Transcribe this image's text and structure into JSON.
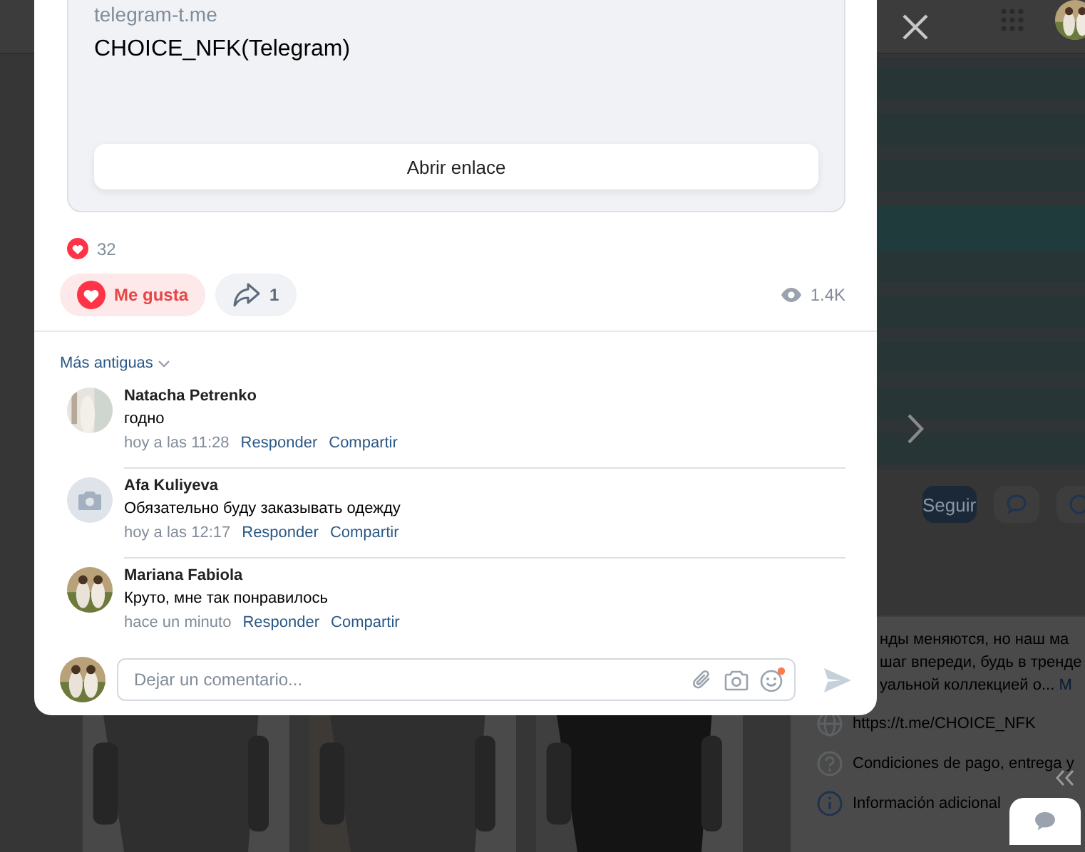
{
  "page": {
    "follow_button": "Seguir",
    "description_lines": [
      "нды меняются, но наш ма",
      "шаг впереди, будь в тренде",
      "уальной коллекцией о..."
    ],
    "more_link": "М",
    "info_links": [
      {
        "kind": "link",
        "text": "https://t.me/CHOICE_NFK"
      },
      {
        "kind": "help",
        "text": "Condiciones de pago, entrega y"
      },
      {
        "kind": "info",
        "text": "Información adicional"
      }
    ]
  },
  "post": {
    "link_card": {
      "domain": "telegram-t.me",
      "title": "CHOICE_NFK(Telegram)",
      "button": "Abrir enlace"
    },
    "reaction_count": "32",
    "like_button": {
      "label": "Me gusta",
      "selected": true
    },
    "share_button": {
      "count": "1"
    },
    "views": "1.4K"
  },
  "comments": {
    "sort": "Más antiguas",
    "items": [
      {
        "author": "Natacha Petrenko",
        "text": "годно",
        "time": "hoy a las 11:28",
        "reply": "Responder",
        "share": "Compartir"
      },
      {
        "author": "Afa Kuliyeva",
        "text": "Обязательно буду заказывать одежду",
        "time": "hoy a las 12:17",
        "reply": "Responder",
        "share": "Compartir",
        "kind": "placeholder"
      },
      {
        "author": "Mariana Fabiola",
        "text": "Круто, мне так понравилось",
        "time": "hace un minuto",
        "reply": "Responder",
        "share": "Compartir"
      }
    ]
  },
  "composer": {
    "placeholder": "Dejar un comentario...",
    "emoji_badge": true
  }
}
